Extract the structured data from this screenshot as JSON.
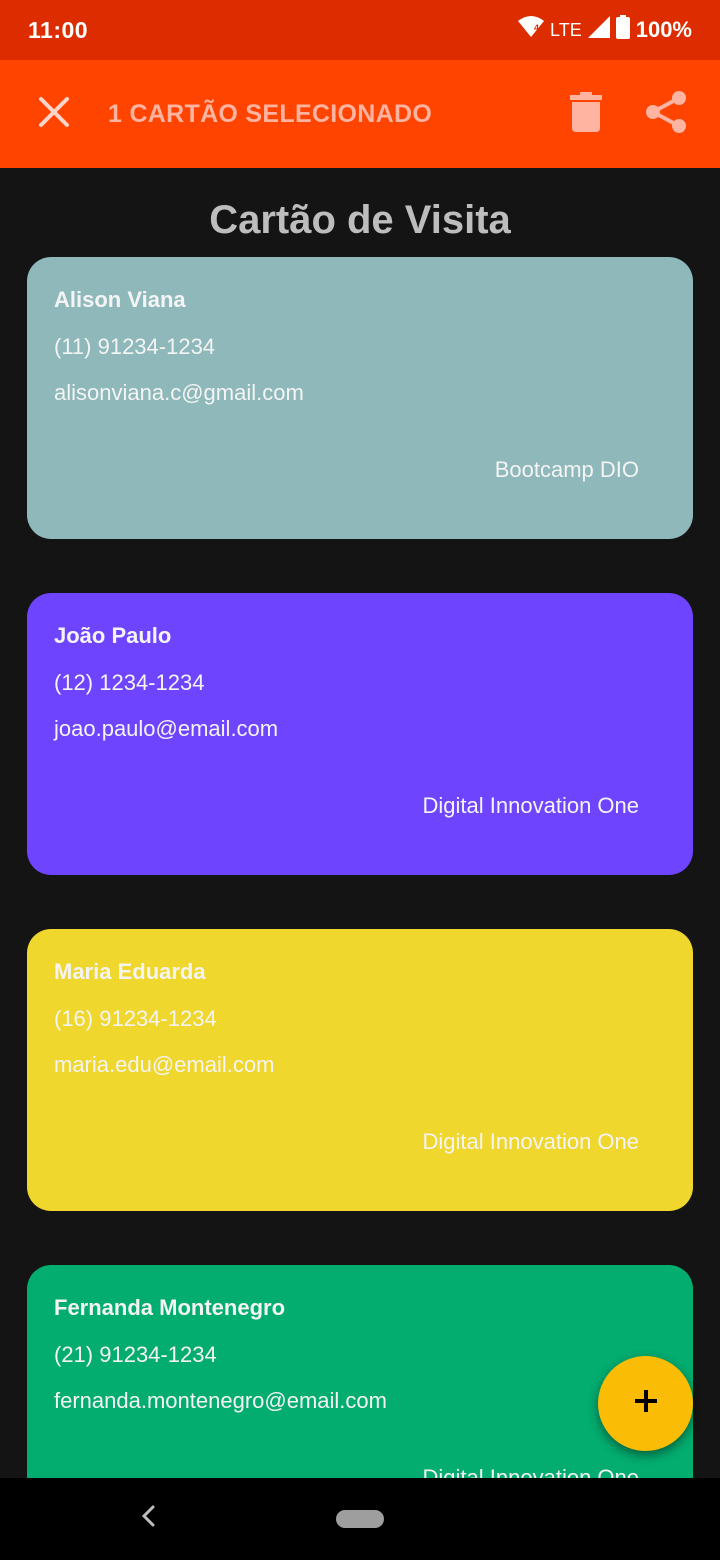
{
  "status_bar": {
    "time": "11:00",
    "network": "LTE",
    "battery": "100%",
    "icons": [
      "wifi-icon",
      "signal-icon",
      "battery-icon"
    ]
  },
  "action_bar": {
    "title": "1 CARTÃO SELECIONADO",
    "icons": [
      "close-icon",
      "delete-icon",
      "share-icon"
    ],
    "color": "#ff4400"
  },
  "page": {
    "title": "Cartão de Visita"
  },
  "cards": [
    {
      "name": "Alison Viana",
      "phone": "(11) 91234-1234",
      "email": "alisonviana.c@gmail.com",
      "company": "Bootcamp DIO",
      "color": "#8eb8ba"
    },
    {
      "name": "João Paulo",
      "phone": "(12) 1234-1234",
      "email": "joao.paulo@email.com",
      "company": "Digital Innovation One",
      "color": "#6e44ff"
    },
    {
      "name": "Maria Eduarda",
      "phone": "(16) 91234-1234",
      "email": "maria.edu@email.com",
      "company": "Digital Innovation One",
      "color": "#f0d72d"
    },
    {
      "name": "Fernanda Montenegro",
      "phone": "(21) 91234-1234",
      "email": "fernanda.montenegro@email.com",
      "company": "Digital Innovation One",
      "color": "#03ac6f"
    }
  ],
  "fab": {
    "icon": "add-icon",
    "color": "#fbbc05"
  },
  "nav_bar": {
    "icons": [
      "back-icon",
      "home-pill-icon"
    ]
  }
}
